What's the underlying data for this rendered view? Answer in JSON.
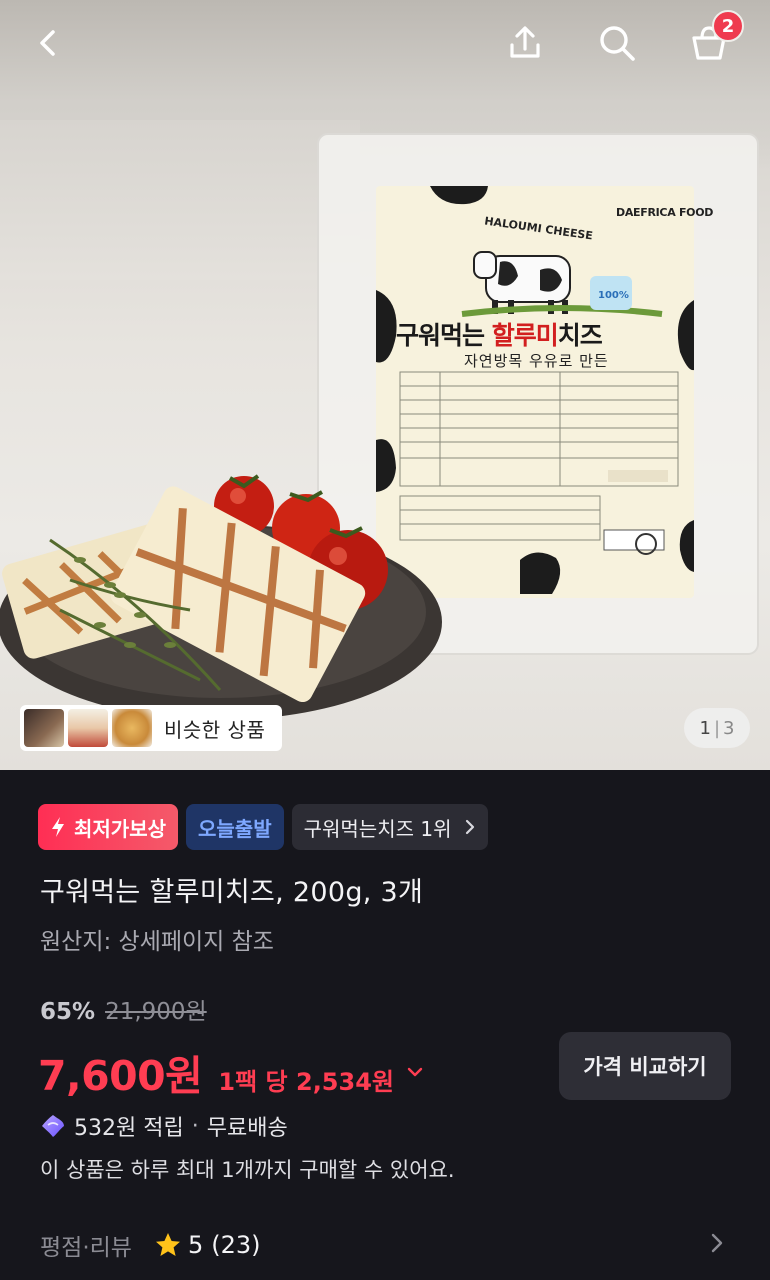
{
  "header": {
    "cart_count": "2"
  },
  "hero": {
    "similar_products_label": "비슷한 상품",
    "pager": {
      "current": "1",
      "total": "3"
    },
    "package": {
      "brand": "DAEFRICA FOOD",
      "cheese_type": "HALOUMI CHEESE",
      "name_prefix": "구워먹는 ",
      "name_highlight": "할루미",
      "name_suffix": "치즈",
      "subtitle": "자연방목 우유로 만든",
      "badge": "100%"
    }
  },
  "tags": {
    "lowest_price": "최저가보상",
    "today_ship": "오늘출발",
    "ranking": "구워먹는치즈 1위"
  },
  "product": {
    "title": "구워먹는 할루미치즈, 200g, 3개",
    "origin": "원산지: 상세페이지 참조",
    "discount": "65%",
    "original_price": "21,900원",
    "price": "7,600원",
    "unit_price": "1팩 당 2,534원",
    "compare_button": "가격 비교하기",
    "reward": "532원 적립",
    "shipping": "무료배송",
    "purchase_limit": "이 상품은 하루 최대 1개까지 구매할 수 있어요."
  },
  "rating": {
    "label": "평점·리뷰",
    "score": "5",
    "count": "(23)"
  },
  "colors": {
    "accent_red": "#ff3d52",
    "tag_blue_bg": "#1f3566",
    "tag_blue_text": "#7ea8ff",
    "background": "#16161c"
  },
  "icons": [
    "back-icon",
    "share-icon",
    "search-icon",
    "cart-icon",
    "chevron-right-icon",
    "chevron-down-icon",
    "lightning-icon",
    "gem-icon",
    "star-icon"
  ]
}
